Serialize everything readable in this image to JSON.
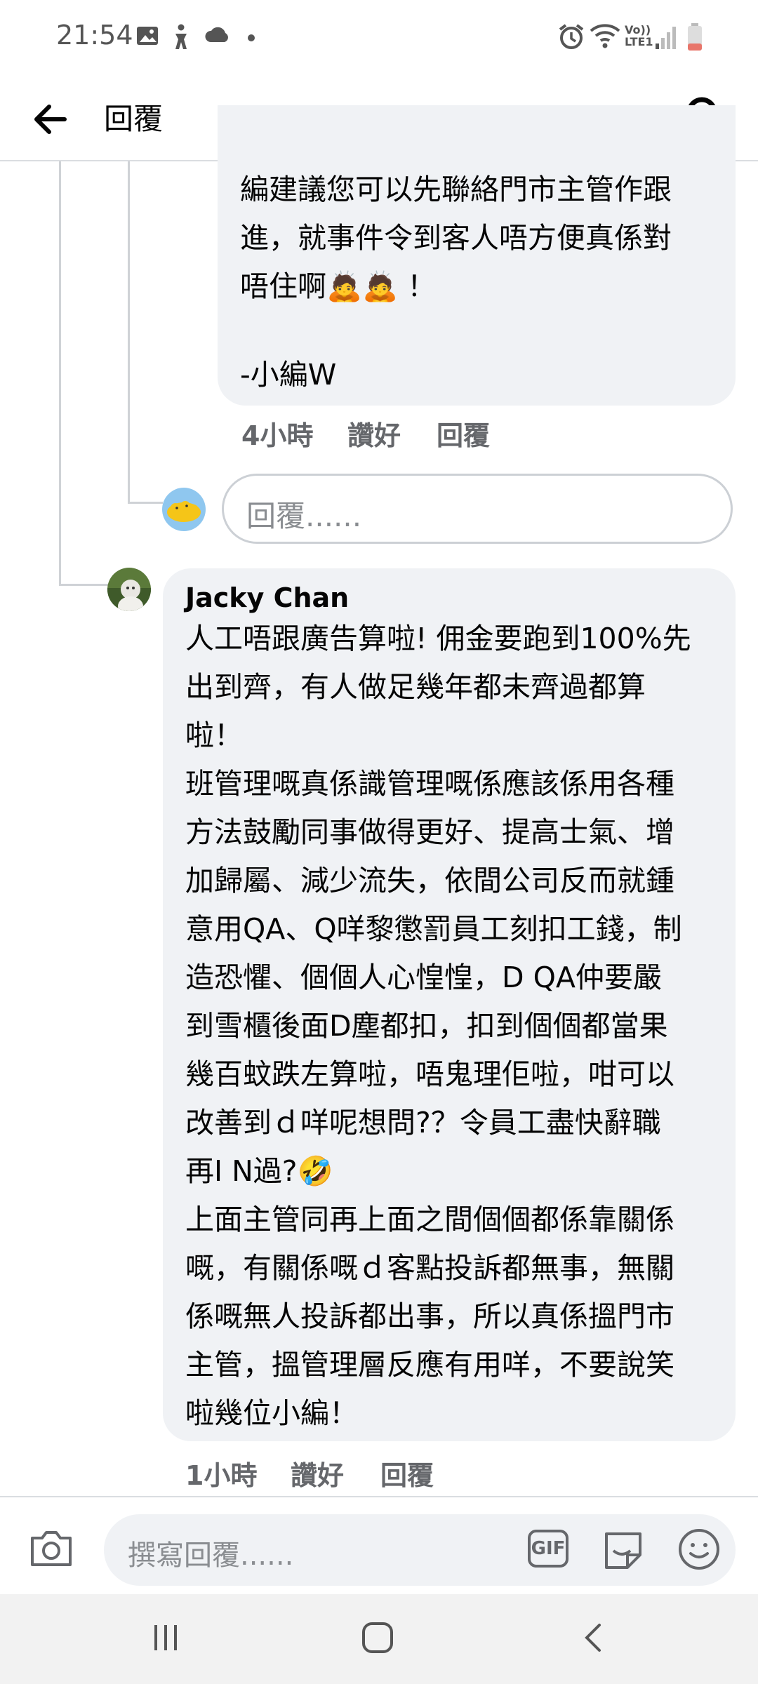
{
  "status_bar": {
    "time": "21:54",
    "icons_left": [
      "gallery-icon",
      "accessibility-icon",
      "cloud-icon",
      "dot-icon"
    ],
    "network_label_top": "Vo))",
    "network_label_bottom": "LTE1",
    "icons_right": [
      "alarm-icon",
      "wifi-icon",
      "signal-icon",
      "battery-icon"
    ]
  },
  "header": {
    "title": "回覆",
    "back_icon": "arrow-left-icon",
    "search_icon": "search-icon"
  },
  "previous_reply": {
    "text": "編建議您可以先聯絡門市主管作跟\n進，就事件令到客人唔方便真係對\n唔住啊",
    "emoji_suffix": "🙇🙇",
    "exclaim": " ！",
    "signature": "-小編W",
    "time": "4小時",
    "like_label": "讚好",
    "reply_label": "回覆"
  },
  "reply_input": {
    "placeholder": "回覆......"
  },
  "comment": {
    "author": "Jacky Chan",
    "text": "人工唔跟廣告算啦! 佣金要跑到100%先\n出到齊，有人做足幾年都未齊過都算\n啦！\n班管理嘅真係識管理嘅係應該係用各種\n方法鼓勵同事做得更好、提高士氣、增\n加歸屬、減少流失，依間公司反而就鍾\n意用QA、Q咩黎懲罰員工刻扣工錢，制\n造恐懼、個個人心惶惶，D QA仲要嚴\n到雪櫃後面D塵都扣，扣到個個都當果\n幾百蚊跌左算啦，唔鬼理佢啦，咁可以\n改善到ｄ咩呢想問?？令員工盡快辭職\n再I N過?",
    "emoji": "🤣",
    "text2": "上面主管同再上面之間個個都係靠關係\n嘅，有關係嘅ｄ客點投訴都無事，無關\n係嘅無人投訴都出事，所以真係搵門市\n主管，搵管理層反應有用咩，不要說笑\n啦幾位小編！",
    "time": "1小時",
    "like_label": "讚好",
    "reply_label": "回覆"
  },
  "composer": {
    "placeholder": "撰寫回覆......",
    "gif_label": "GIF"
  },
  "colors": {
    "bubble_bg": "#f0f2f5",
    "meta_text": "#65676b",
    "thread_line": "#cfd2d6"
  }
}
